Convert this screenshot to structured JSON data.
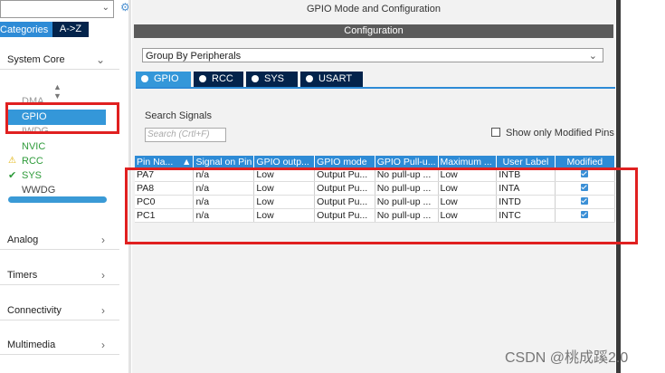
{
  "sidebar": {
    "tabs": {
      "categories": "Categories",
      "az": "A->Z"
    },
    "sections": {
      "system_core": "System Core",
      "analog": "Analog",
      "timers": "Timers",
      "connectivity": "Connectivity",
      "multimedia": "Multimedia"
    },
    "peripherals": [
      "DMA",
      "GPIO",
      "IWDG",
      "NVIC",
      "RCC",
      "SYS",
      "WWDG"
    ]
  },
  "main": {
    "title": "GPIO Mode and Configuration",
    "config_label": "Configuration",
    "group_by": "Group By Peripherals",
    "tabs": [
      "GPIO",
      "RCC",
      "SYS",
      "USART"
    ],
    "search_label": "Search Signals",
    "search_placeholder": "Search (Crtl+F)",
    "show_modified": "Show only Modified Pins"
  },
  "table": {
    "headers": [
      "Pin Na...",
      "Signal on Pin",
      "GPIO outp...",
      "GPIO mode",
      "GPIO Pull-u...",
      "Maximum ...",
      "User Label",
      "Modified"
    ],
    "rows": [
      [
        "PA7",
        "n/a",
        "Low",
        "Output Pu...",
        "No pull-up ...",
        "Low",
        "INTB",
        true
      ],
      [
        "PA8",
        "n/a",
        "Low",
        "Output Pu...",
        "No pull-up ...",
        "Low",
        "INTA",
        true
      ],
      [
        "PC0",
        "n/a",
        "Low",
        "Output Pu...",
        "No pull-up ...",
        "Low",
        "INTD",
        true
      ],
      [
        "PC1",
        "n/a",
        "Low",
        "Output Pu...",
        "No pull-up ...",
        "Low",
        "INTC",
        true
      ]
    ]
  },
  "watermark": "CSDN @桃成蹊2.0",
  "colors": {
    "accent": "#2e8bd6",
    "dark_tab": "#03234b",
    "annotation": "#e02020"
  }
}
